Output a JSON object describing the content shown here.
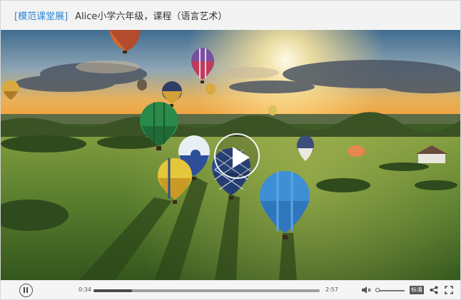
{
  "header": {
    "tag": "[模范课堂展]",
    "title": "Alice小学六年级，课程（语言艺术）"
  },
  "player": {
    "current_time": "0:34",
    "total_time": "2:57",
    "progress": 0.17,
    "volume": 0.05,
    "speed_label": "标清"
  },
  "icons": {
    "play": "play-icon",
    "pause": "pause-icon",
    "volume": "volume-mute-icon",
    "share": "share-icon",
    "fullscreen": "fullscreen-icon"
  },
  "colors": {
    "tag": "#2e86d6",
    "title": "#333333",
    "control_bar": "#f5f5f5"
  }
}
